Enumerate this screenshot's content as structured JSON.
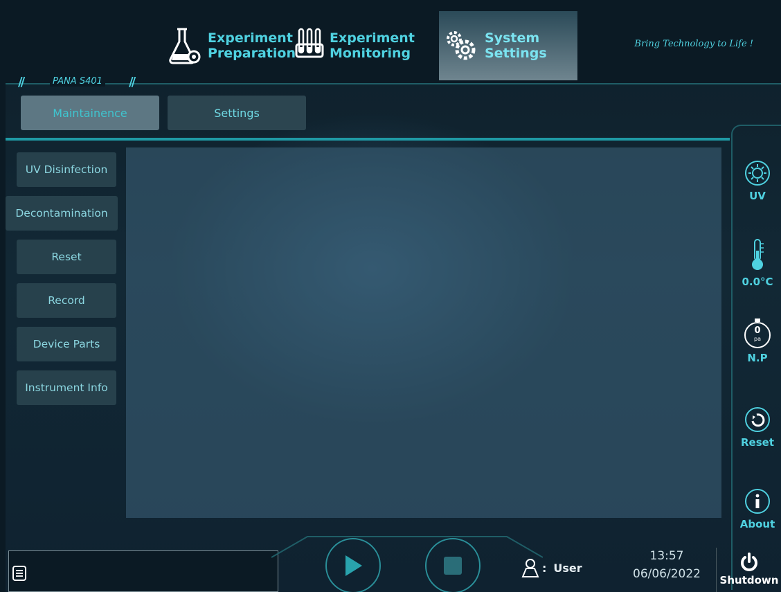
{
  "top_nav": {
    "tabs": [
      {
        "label": "Experiment\nPreparation",
        "icon": "flask-gear-icon"
      },
      {
        "label": "Experiment\nMonitoring",
        "icon": "tube-rack-icon"
      },
      {
        "label": "System\nSettings",
        "icon": "gears-icon",
        "active": true
      }
    ],
    "tagline": "Bring Technology to Life !"
  },
  "device": {
    "model": "PANA S401"
  },
  "sub_tabs": [
    {
      "label": "Maintainence",
      "active": true
    },
    {
      "label": "Settings",
      "active": false
    }
  ],
  "side_menu": {
    "items": [
      {
        "label": "UV Disinfection"
      },
      {
        "label": "Decontamination"
      },
      {
        "label": "Reset"
      },
      {
        "label": "Record"
      },
      {
        "label": "Device Parts"
      },
      {
        "label": "Instrument Info"
      }
    ]
  },
  "right_rail": {
    "uv_label": "UV",
    "temperature_label": "0.0°C",
    "pressure_value": "0",
    "pressure_unit": "pa",
    "pressure_label": "N.P",
    "reset_label": "Reset",
    "about_label": "About"
  },
  "bottom_bar": {
    "user_label": "User",
    "user_separator": ":",
    "time": "13:57",
    "date": "06/06/2022",
    "shutdown_label": "Shutdown"
  },
  "colors": {
    "accent": "#4fd1e0",
    "background": "#0b1a24",
    "panel": "#3e647c"
  }
}
